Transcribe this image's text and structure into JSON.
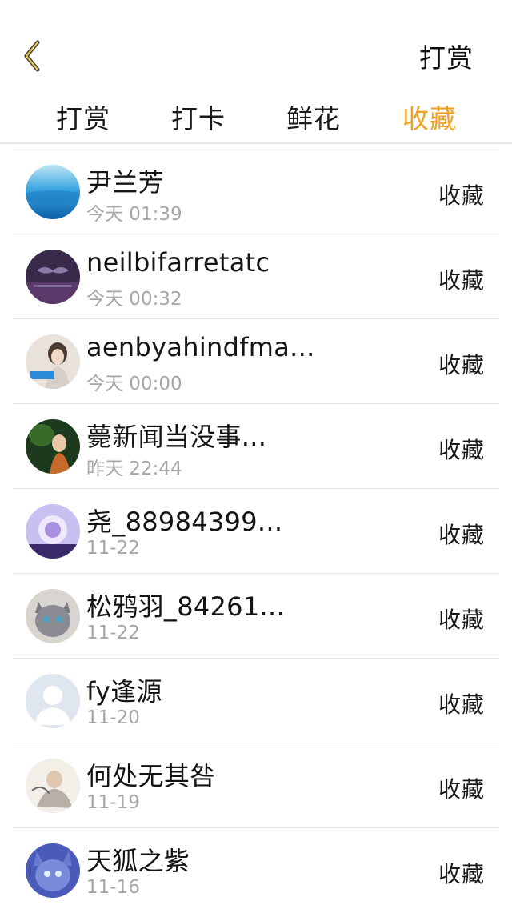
{
  "header": {
    "title": "打赏",
    "back_icon": "chevron-left-icon",
    "accent_color": "#f0a020"
  },
  "tabs": [
    {
      "label": "打赏",
      "active": false
    },
    {
      "label": "打卡",
      "active": false
    },
    {
      "label": "鲜花",
      "active": false
    },
    {
      "label": "收藏",
      "active": true
    }
  ],
  "list": {
    "items": [
      {
        "name": "尹兰芳",
        "time": "今天 01:39",
        "action": "收藏"
      },
      {
        "name": "neilbifarretatc",
        "time": "今天 00:32",
        "action": "收藏"
      },
      {
        "name": "aenbyahindfma...",
        "time": "今天 00:00",
        "action": "收藏"
      },
      {
        "name": "薨新闻当没事...",
        "time": "昨天 22:44",
        "action": "收藏"
      },
      {
        "name": "尧_88984399...",
        "time": "11-22",
        "action": "收藏"
      },
      {
        "name": "松鸦羽_84261...",
        "time": "11-22",
        "action": "收藏"
      },
      {
        "name": "fy逢源",
        "time": "11-20",
        "action": "收藏"
      },
      {
        "name": "何处无其咎",
        "time": "11-19",
        "action": "收藏"
      },
      {
        "name": "天狐之紫",
        "time": "11-16",
        "action": "收藏"
      }
    ]
  }
}
